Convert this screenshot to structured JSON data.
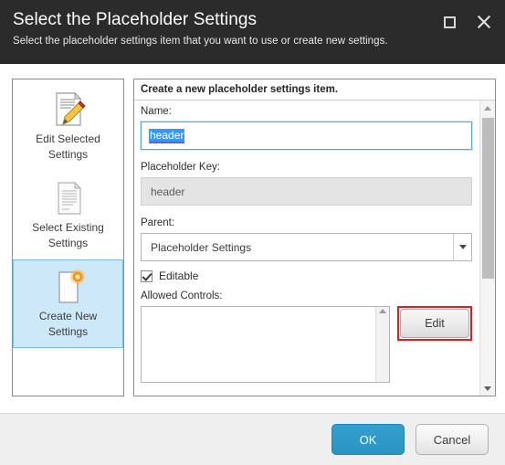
{
  "window": {
    "title": "Select the Placeholder Settings",
    "subtitle": "Select the placeholder settings item that you want to use or create new settings.",
    "controls": {
      "maximize": "maximize",
      "close": "close"
    }
  },
  "sidebar": {
    "items": [
      {
        "label_line1": "Edit Selected",
        "label_line2": "Settings",
        "icon": "document-pencil-icon",
        "selected": false
      },
      {
        "label_line1": "Select Existing",
        "label_line2": "Settings",
        "icon": "document-gray-icon",
        "selected": false
      },
      {
        "label_line1": "Create New",
        "label_line2": "Settings",
        "icon": "document-new-star-icon",
        "selected": true
      }
    ]
  },
  "panel": {
    "header": "Create a new placeholder settings item.",
    "fields": {
      "name": {
        "label": "Name:",
        "value": "header"
      },
      "placeholder_key": {
        "label": "Placeholder Key:",
        "value": "header"
      },
      "parent": {
        "label": "Parent:",
        "value": "Placeholder Settings"
      },
      "editable": {
        "label": "Editable",
        "checked": true
      },
      "allowed_controls": {
        "label": "Allowed Controls:",
        "items": [],
        "edit_button": "Edit"
      }
    }
  },
  "footer": {
    "ok_label": "OK",
    "cancel_label": "Cancel"
  },
  "colors": {
    "titlebar_bg": "#2b2b2b",
    "accent_ok": "#2a93c4",
    "selection_blue": "#3399ff",
    "sidebar_selected_bg": "#cde8f8",
    "highlight_red": "#e41b1b",
    "spellcheck_red": "#e02020"
  }
}
